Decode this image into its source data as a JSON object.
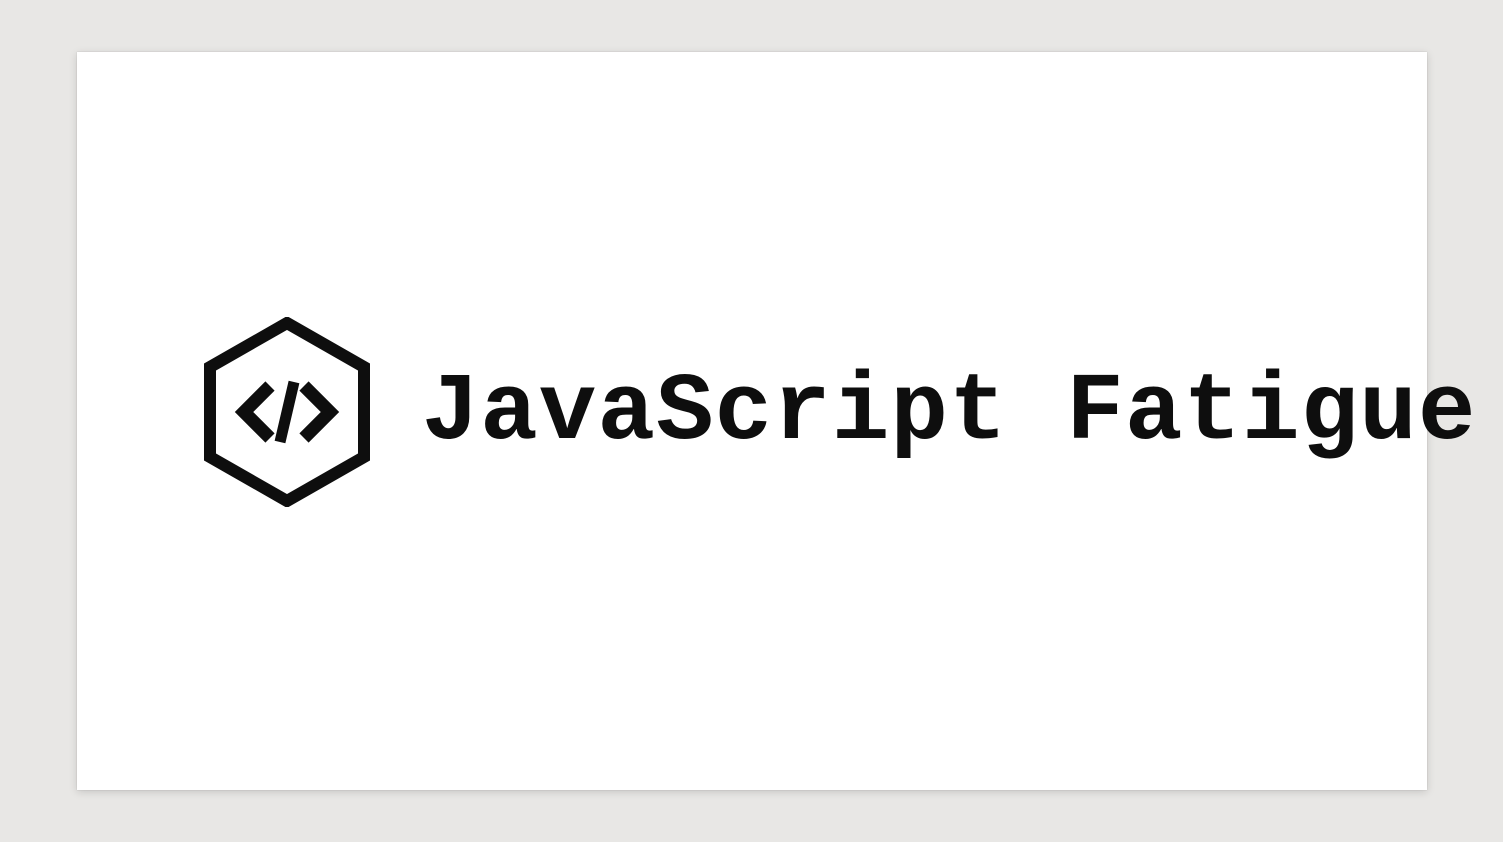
{
  "slide": {
    "title": "JavaScript Fatigue",
    "icon_name": "code-hexagon-icon"
  }
}
